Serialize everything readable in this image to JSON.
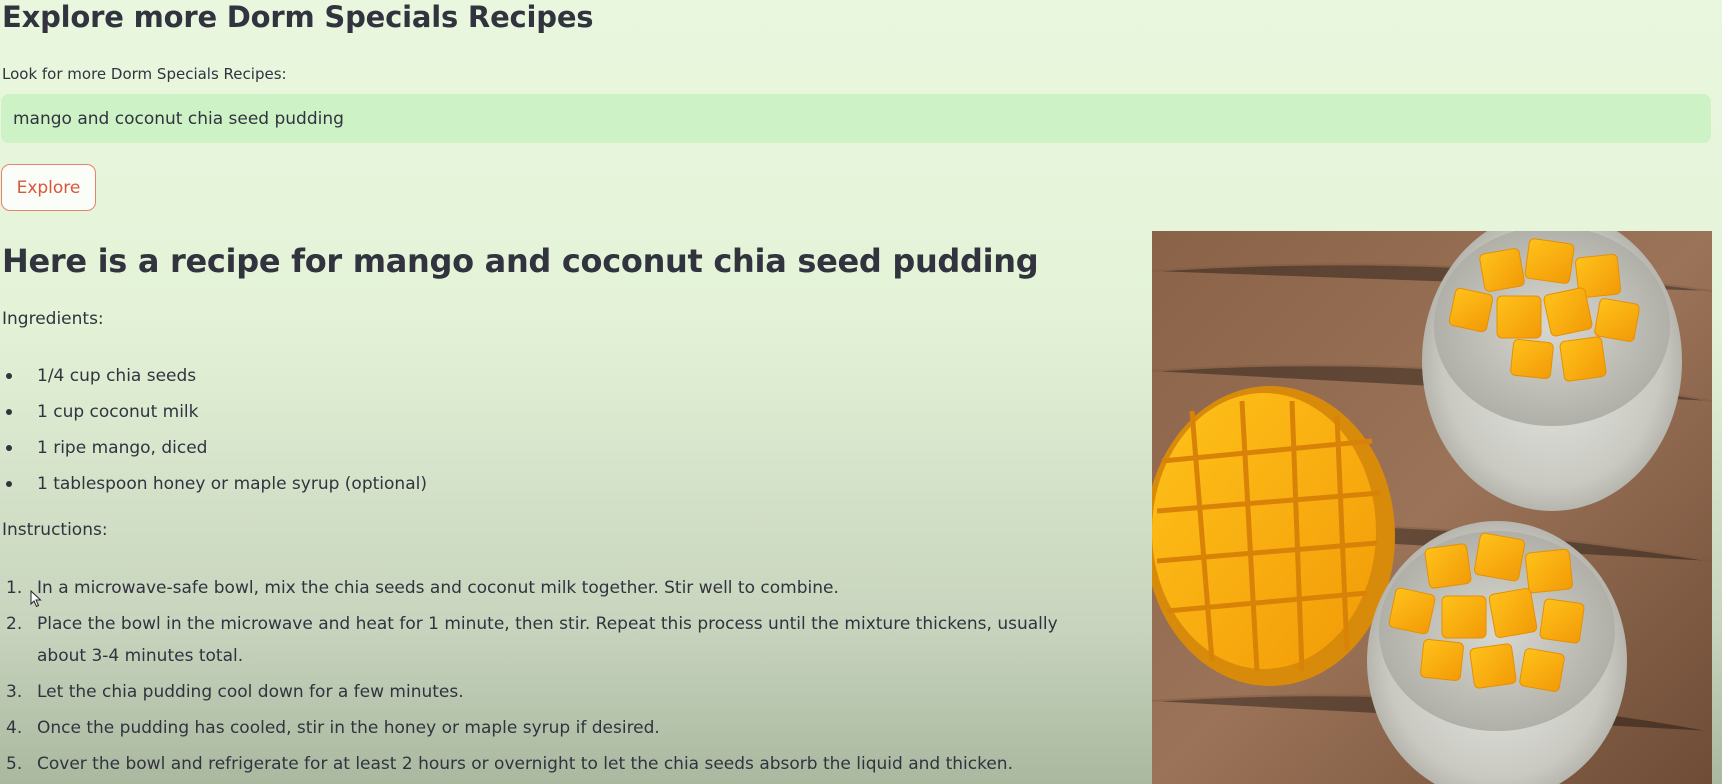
{
  "header": {
    "title": "Explore more Dorm Specials Recipes"
  },
  "search": {
    "label": "Look for more Dorm Specials Recipes:",
    "value": "mango and coconut chia seed pudding"
  },
  "explore_button": {
    "label": "Explore"
  },
  "recipe": {
    "title": "Here is a recipe for mango and coconut chia seed pudding",
    "ingredients_label": "Ingredients:",
    "ingredients": [
      "1/4 cup chia seeds",
      "1 cup coconut milk",
      "1 ripe mango, diced",
      "1 tablespoon honey or maple syrup (optional)"
    ],
    "instructions_label": "Instructions:",
    "instructions": [
      {
        "num": "1.",
        "text": "In a microwave-safe bowl, mix the chia seeds and coconut milk together. Stir well to combine."
      },
      {
        "num": "2.",
        "text": "Place the bowl in the microwave and heat for 1 minute, then stir. Repeat this process until the mixture thickens, usually about 3-4 minutes total."
      },
      {
        "num": "3.",
        "text": "Let the chia pudding cool down for a few minutes."
      },
      {
        "num": "4.",
        "text": "Once the pudding has cooled, stir in the honey or maple syrup if desired."
      },
      {
        "num": "5.",
        "text": "Cover the bowl and refrigerate for at least 2 hours or overnight to let the chia seeds absorb the liquid and thicken."
      }
    ]
  },
  "colors": {
    "accent": "#d9563d",
    "input_bg": "#cdf2c6",
    "text": "#31333f"
  }
}
